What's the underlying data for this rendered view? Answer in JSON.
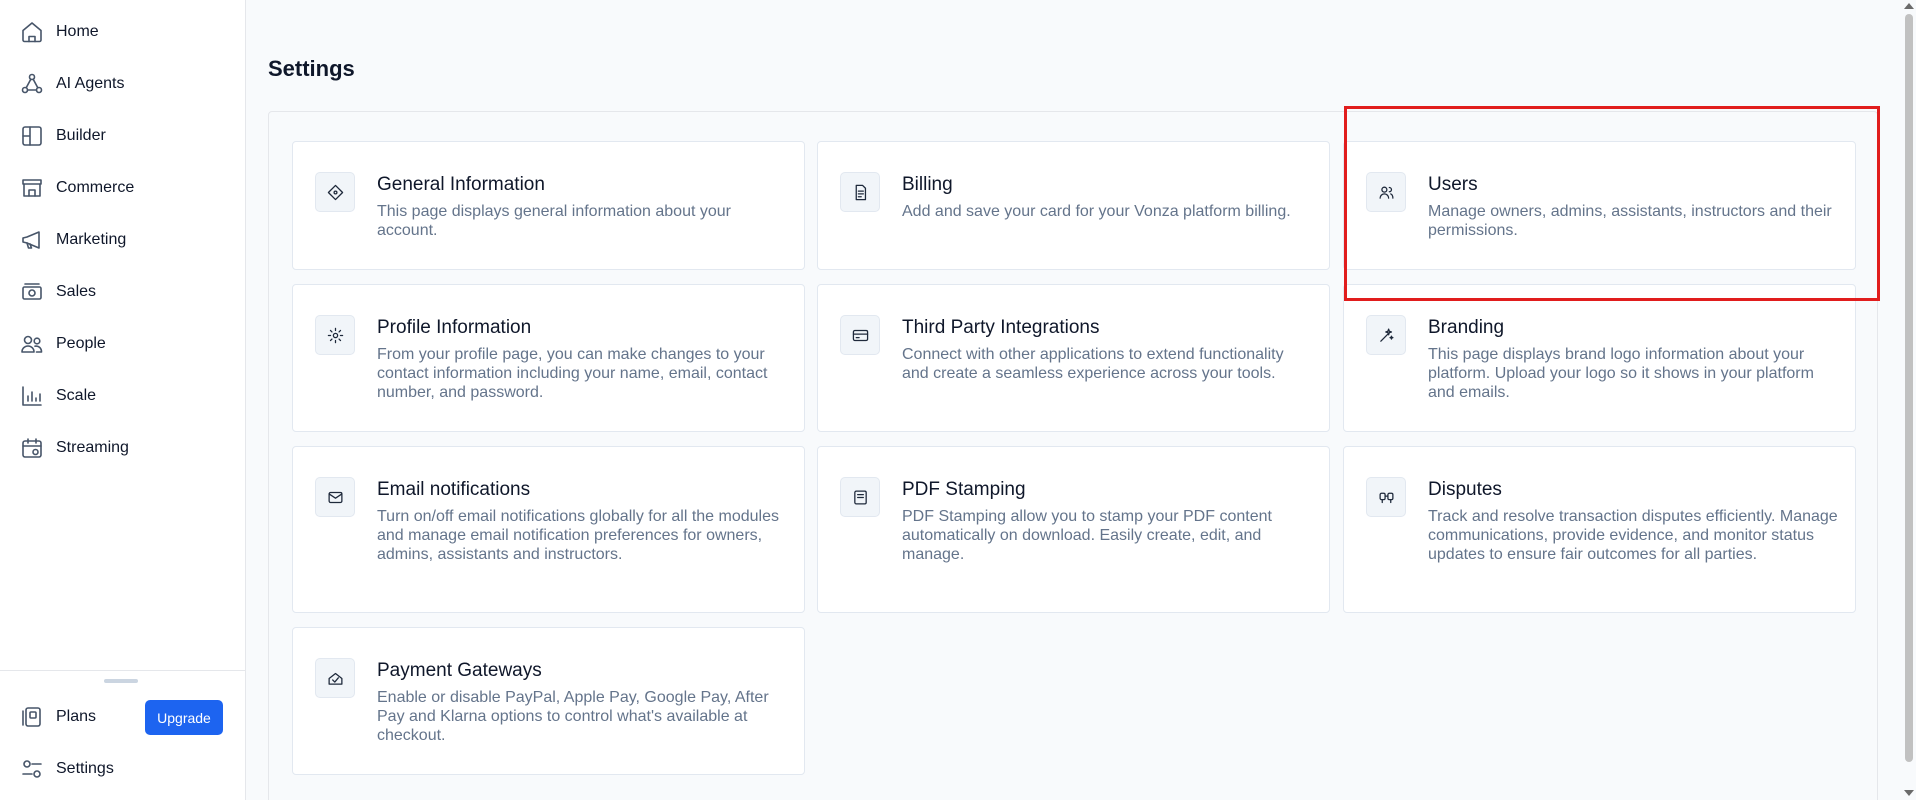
{
  "sidebar": {
    "items": [
      {
        "label": "Home",
        "icon": "home-icon"
      },
      {
        "label": "AI Agents",
        "icon": "ai-agents-icon"
      },
      {
        "label": "Builder",
        "icon": "builder-icon"
      },
      {
        "label": "Commerce",
        "icon": "commerce-icon"
      },
      {
        "label": "Marketing",
        "icon": "megaphone-icon"
      },
      {
        "label": "Sales",
        "icon": "sales-icon"
      },
      {
        "label": "People",
        "icon": "people-icon"
      },
      {
        "label": "Scale",
        "icon": "bar-chart-icon"
      },
      {
        "label": "Streaming",
        "icon": "calendar-icon"
      }
    ],
    "bottom": {
      "plans_label": "Plans",
      "upgrade_label": "Upgrade",
      "settings_label": "Settings"
    }
  },
  "main": {
    "title": "Settings",
    "cards": [
      {
        "title": "General Information",
        "description": "This page displays general information about your account.",
        "icon": "general-info-icon"
      },
      {
        "title": "Billing",
        "description": "Add and save your card for your Vonza platform billing.",
        "icon": "billing-icon"
      },
      {
        "title": "Users",
        "description": "Manage owners, admins, assistants, instructors and their permissions.",
        "icon": "users-icon"
      },
      {
        "title": "Profile Information",
        "description": "From your profile page, you can make changes to your contact information including your name, email, contact number, and password.",
        "icon": "profile-icon"
      },
      {
        "title": "Third Party Integrations",
        "description": "Connect with other applications to extend functionality and create a seamless experience across your tools.",
        "icon": "integrations-icon"
      },
      {
        "title": "Branding",
        "description": "This page displays brand logo information about your platform. Upload your logo so it shows in your platform and emails.",
        "icon": "branding-icon"
      },
      {
        "title": "Email notifications",
        "description": "Turn on/off email notifications globally for all the modules and manage email notification preferences for owners, admins, assistants and instructors.",
        "icon": "email-icon"
      },
      {
        "title": "PDF Stamping",
        "description": "PDF Stamping allow you to stamp your PDF content automatically on download. Easily create, edit, and manage.",
        "icon": "pdf-stamp-icon"
      },
      {
        "title": "Disputes",
        "description": "Track and resolve transaction disputes efficiently. Manage communications, provide evidence, and monitor status updates to ensure fair outcomes for all parties.",
        "icon": "disputes-icon"
      },
      {
        "title": "Payment Gateways",
        "description": "Enable or disable PayPal, Apple Pay, Google Pay, After Pay and Klarna options to control what's available at checkout.",
        "icon": "payment-gateways-icon"
      }
    ]
  },
  "colors": {
    "accent": "#1d64f0",
    "highlight": "#e11d1d"
  }
}
